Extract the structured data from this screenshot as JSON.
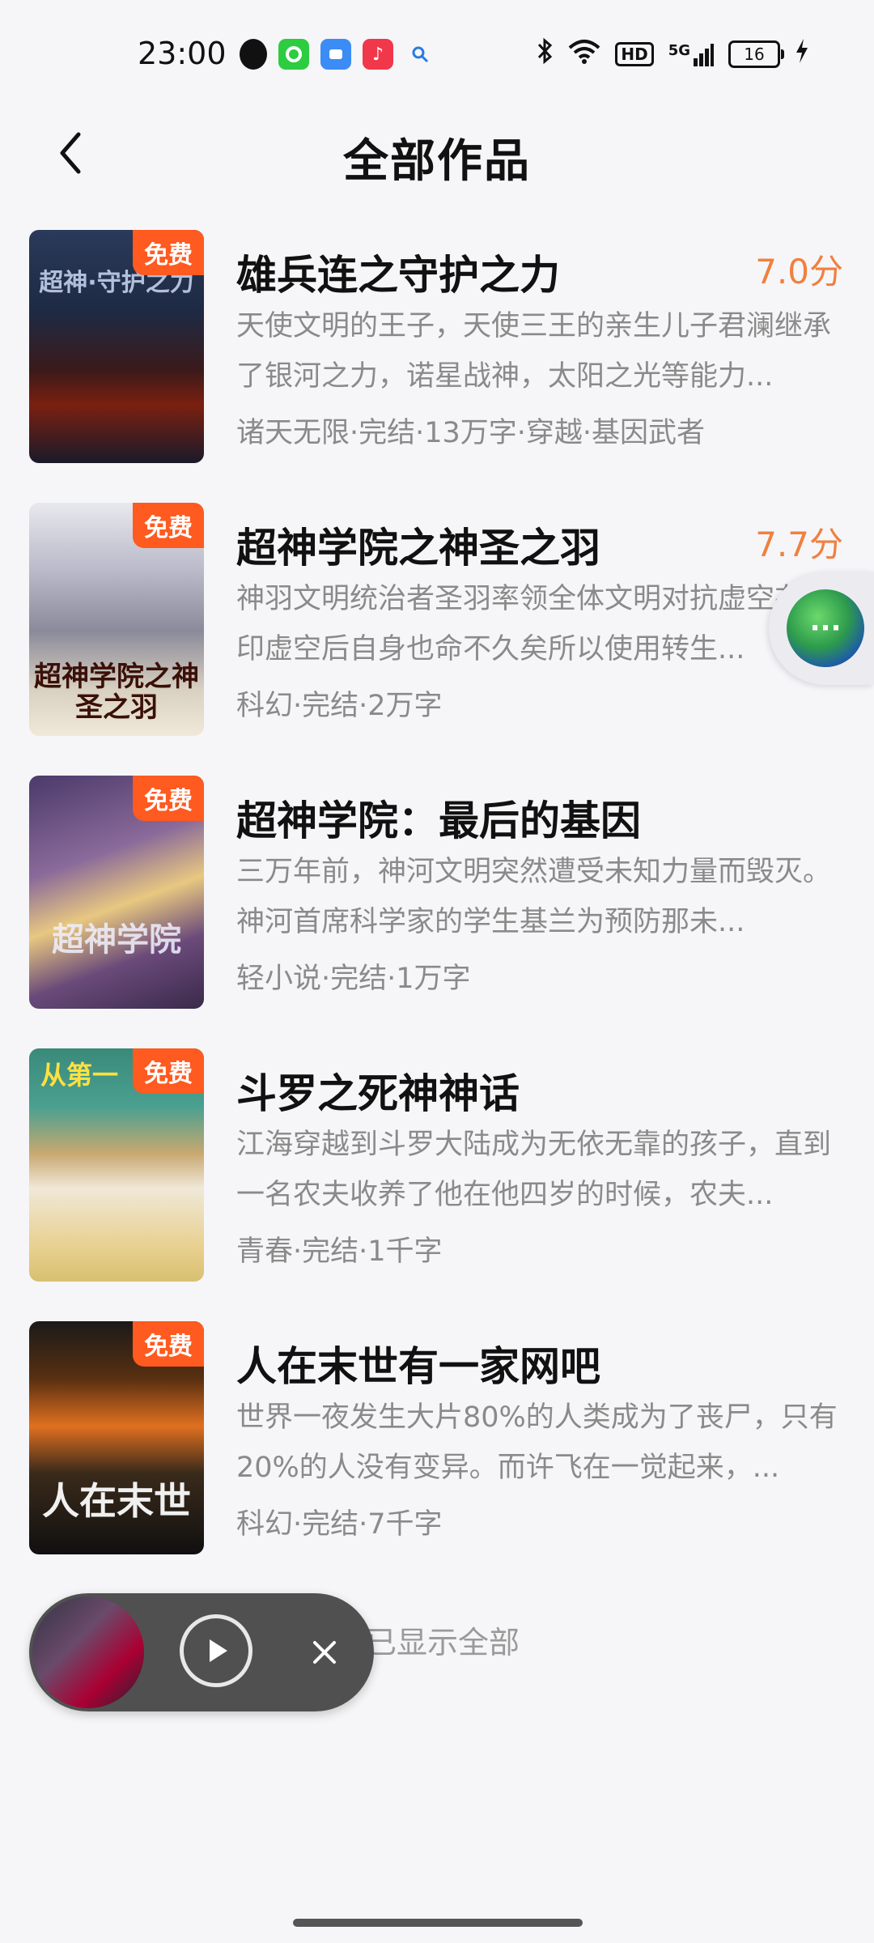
{
  "status_bar": {
    "time": "23:00",
    "hd": "HD",
    "signal": "5G",
    "battery": "16"
  },
  "header": {
    "title": "全部作品"
  },
  "books": [
    {
      "title": "雄兵连之守护之力",
      "score": "7.0分",
      "badge": "免费",
      "description": "天使文明的王子，天使三王的亲生儿子君澜继承了银河之力，诺星战神，太阳之光等能力...",
      "meta": "诸天无限·完结·13万字·穿越·基因武者",
      "cover_text": "超神·守护之力"
    },
    {
      "title": "超神学院之神圣之羽",
      "score": "7.7分",
      "badge": "免费",
      "description": "神羽文明统治者圣羽率领全体文明对抗虚空在封印虚空后自身也命不久矣所以使用转生...",
      "meta": "科幻·完结·2万字",
      "cover_text": "超神学院之神圣之羽"
    },
    {
      "title": "超神学院：最后的基因",
      "score": "",
      "badge": "免费",
      "description": "三万年前，神河文明突然遭受未知力量而毁灭。神河首席科学家的学生基兰为预防那未...",
      "meta": "轻小说·完结·1万字",
      "cover_text": "超神学院"
    },
    {
      "title": "斗罗之死神神话",
      "score": "",
      "badge": "免费",
      "description": "江海穿越到斗罗大陆成为无依无靠的孩子，直到一名农夫收养了他在他四岁的时候，农夫...",
      "meta": "青春·完结·1千字",
      "cover_text": "从第一"
    },
    {
      "title": "人在末世有一家网吧",
      "score": "",
      "badge": "免费",
      "description": "世界一夜发生大片80%的人类成为了丧尸，只有20%的人没有变异。而许飞在一觉起来，...",
      "meta": "科幻·完结·7千字",
      "cover_text": "人在末世"
    }
  ],
  "footer": {
    "end_text": "已显示全部"
  },
  "colors": {
    "badge": "#ff5a1f",
    "score": "#f08040",
    "meta": "#8a8a8a"
  }
}
